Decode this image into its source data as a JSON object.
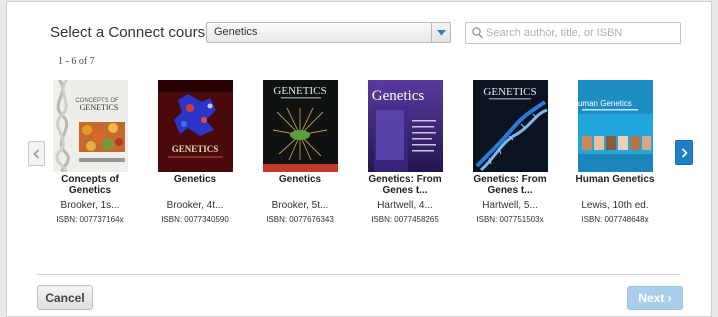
{
  "header": {
    "select_label": "Select a Connect course:",
    "course_select_value": "Genetics",
    "search_placeholder": "Search author, title, or ISBN"
  },
  "results": {
    "count_text": "1 - 6 of 7"
  },
  "books": [
    {
      "title": "Concepts of Genetics",
      "author": "Brooker, 1s...",
      "isbn": "ISBN: 007737164x",
      "cover_text": "CONCEPTS OF GENETICS"
    },
    {
      "title": "Genetics",
      "author": "Brooker, 4t...",
      "isbn": "ISBN: 0077340590",
      "cover_text": "GENETICS"
    },
    {
      "title": "Genetics",
      "author": "Brooker, 5t...",
      "isbn": "ISBN: 0077676343",
      "cover_text": "GENETICS"
    },
    {
      "title": "Genetics: From Genes t...",
      "author": "Hartwell, 4...",
      "isbn": "ISBN: 0077458265",
      "cover_text": "Genetics"
    },
    {
      "title": "Genetics: From Genes t...",
      "author": "Hartwell, 5...",
      "isbn": "ISBN: 007751503x",
      "cover_text": "GENETICS"
    },
    {
      "title": "Human Genetics",
      "author": "Lewis, 10th ed.",
      "isbn": "ISBN: 007748648x",
      "cover_text": "Human Genetics"
    }
  ],
  "footer": {
    "cancel_label": "Cancel",
    "next_label": "Next ›"
  },
  "icons": {
    "prev": "chevron-left-icon",
    "next": "chevron-right-icon",
    "search": "search-icon",
    "dropdown": "caret-down-icon"
  },
  "colors": {
    "accent": "#1e7fc6",
    "next_disabled": "#a9cdea",
    "caret": "#2f7fc0"
  }
}
